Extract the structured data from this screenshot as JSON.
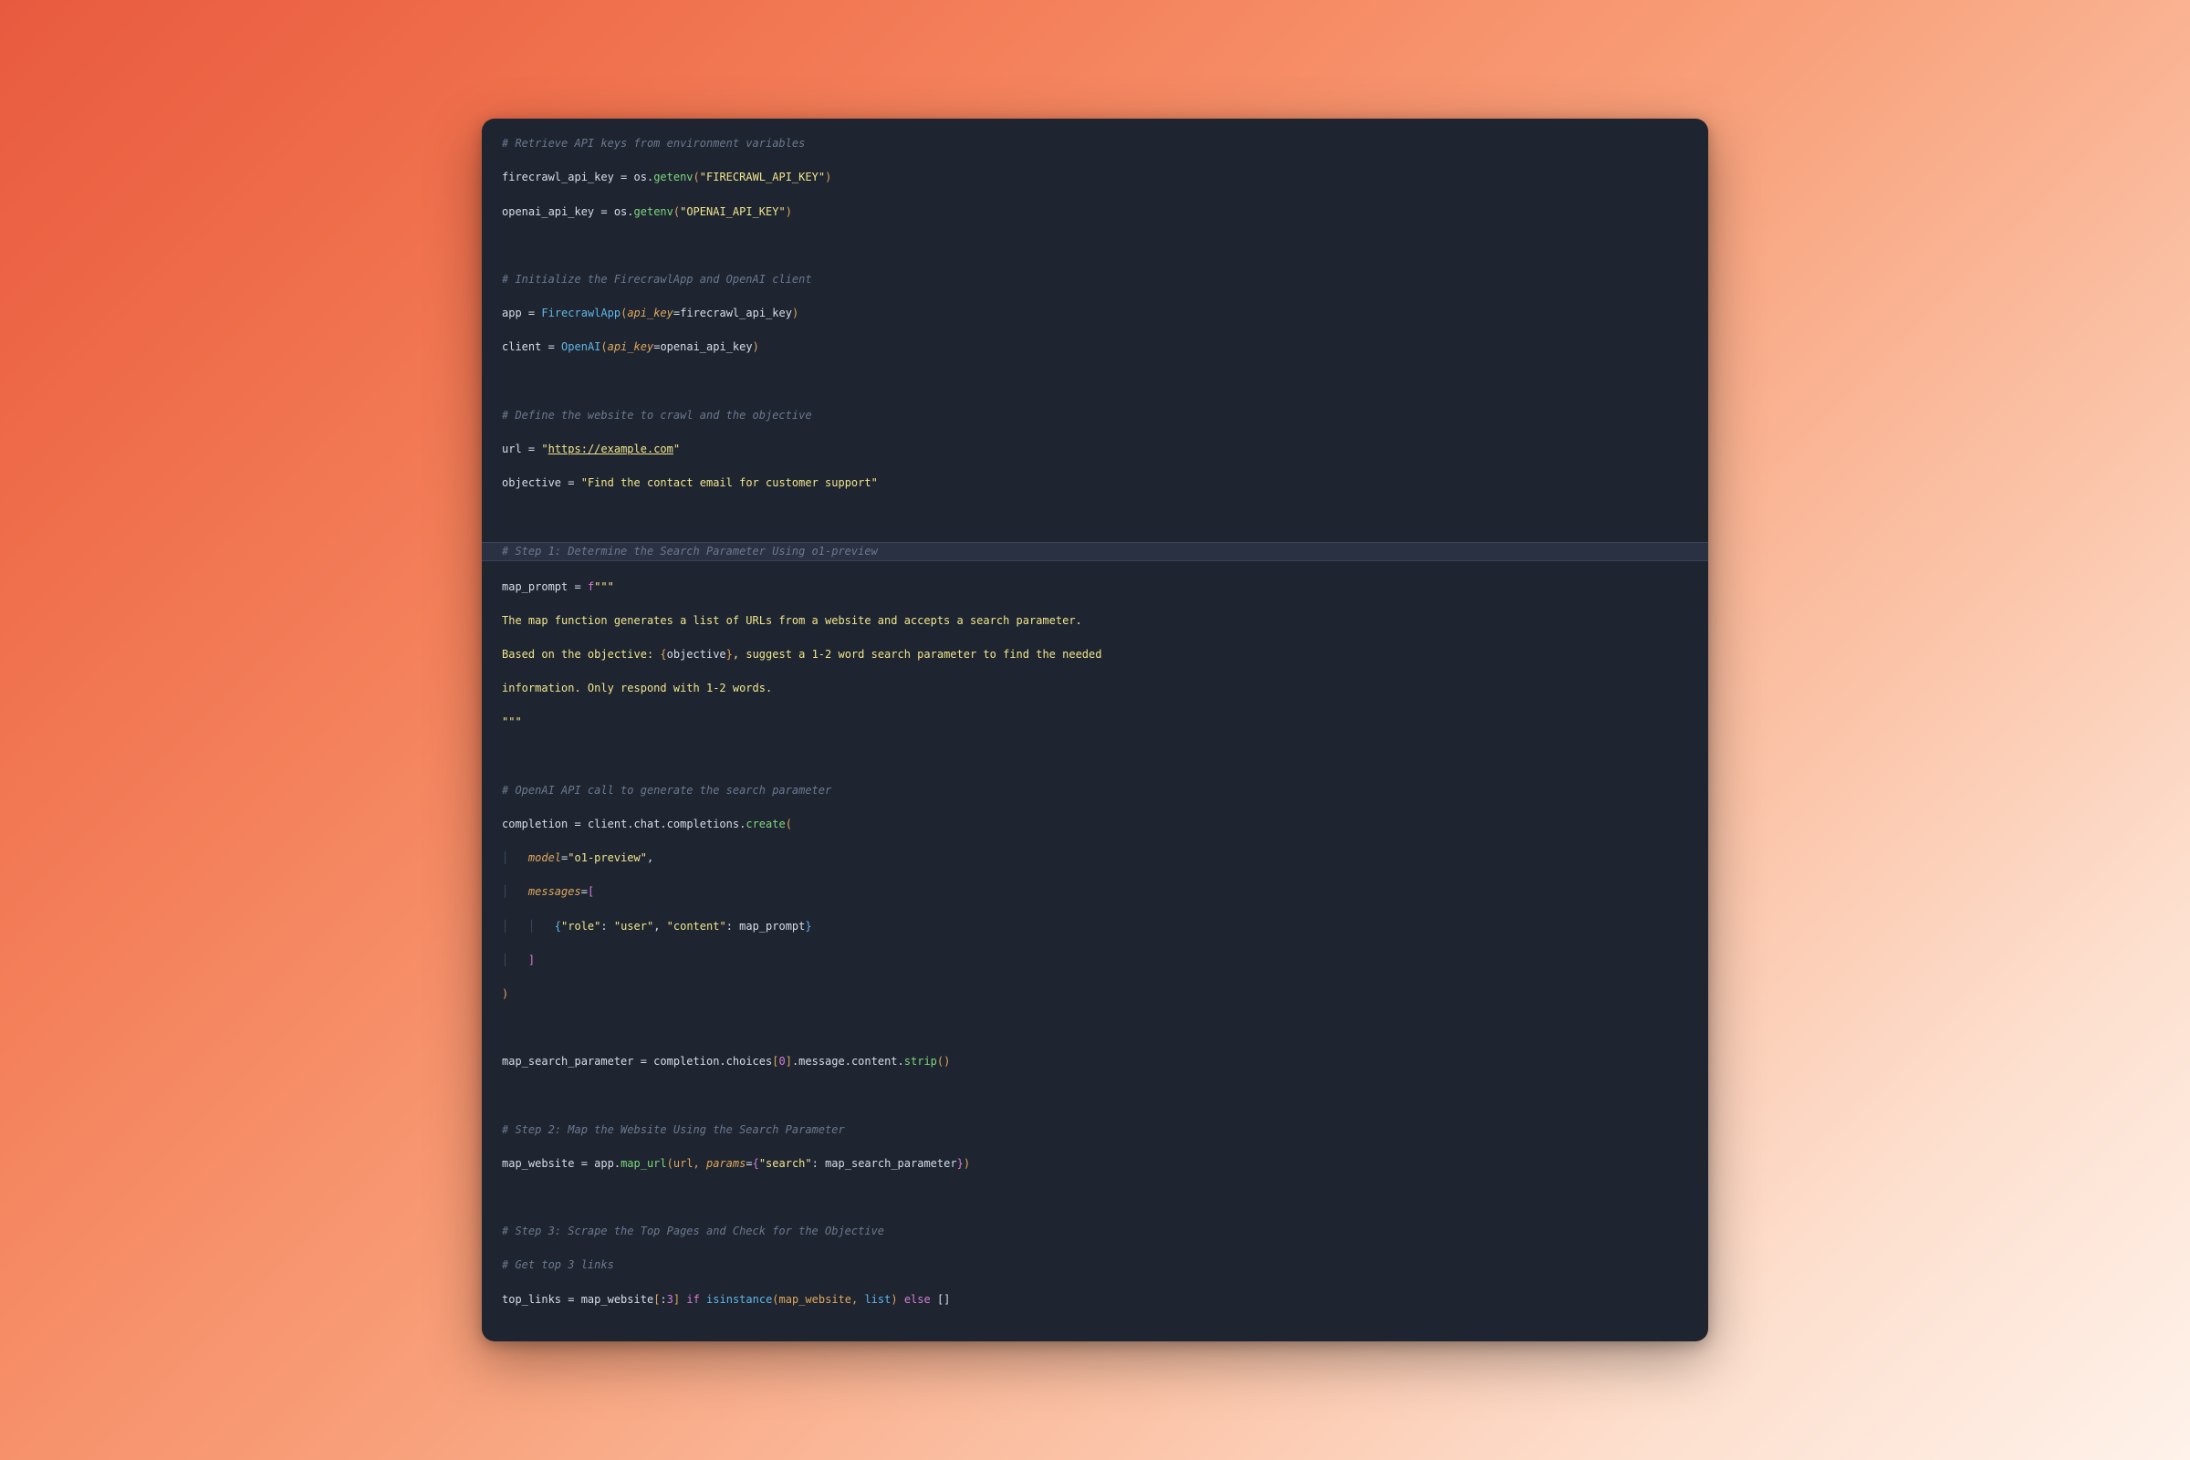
{
  "code": {
    "l1": "# Retrieve API keys from environment variables",
    "l2a": "firecrawl_api_key ",
    "l2b": "=",
    "l2c": " os.",
    "l2d": "getenv",
    "l2e": "(",
    "l2f": "\"FIRECRAWL_API_KEY\"",
    "l2g": ")",
    "l3a": "openai_api_key ",
    "l3b": "=",
    "l3c": " os.",
    "l3d": "getenv",
    "l3e": "(",
    "l3f": "\"OPENAI_API_KEY\"",
    "l3g": ")",
    "l5": "# Initialize the FirecrawlApp and OpenAI client",
    "l6a": "app ",
    "l6b": "=",
    "l6c": " ",
    "l6d": "FirecrawlApp",
    "l6e": "(",
    "l6f": "api_key",
    "l6g": "=",
    "l6h": "firecrawl_api_key",
    "l6i": ")",
    "l7a": "client ",
    "l7b": "=",
    "l7c": " ",
    "l7d": "OpenAI",
    "l7e": "(",
    "l7f": "api_key",
    "l7g": "=",
    "l7h": "openai_api_key",
    "l7i": ")",
    "l9": "# Define the website to crawl and the objective",
    "l10a": "url ",
    "l10b": "=",
    "l10c": " ",
    "l10d": "\"",
    "l10e": "https://example.com",
    "l10f": "\"",
    "l11a": "objective ",
    "l11b": "=",
    "l11c": " ",
    "l11d": "\"Find the contact email for customer support\"",
    "l13": "# Step 1: Determine the Search Parameter Using o1-preview",
    "l14a": "map_prompt ",
    "l14b": "=",
    "l14c": " ",
    "l14d": "f",
    "l14e": "\"\"\"",
    "l15": "The map function generates a list of URLs from a website and accepts a search parameter.",
    "l16a": "Based on the objective: ",
    "l16b": "{",
    "l16c": "objective",
    "l16d": "}",
    "l16e": ", suggest a 1-2 word search parameter to find the needed",
    "l17": "information. Only respond with 1-2 words.",
    "l18": "\"\"\"",
    "l20": "# OpenAI API call to generate the search parameter",
    "l21a": "completion ",
    "l21b": "=",
    "l21c": " client.chat.completions.",
    "l21d": "create",
    "l21e": "(",
    "l22a": "    ",
    "l22b": "model",
    "l22c": "=",
    "l22d": "\"o1-preview\"",
    "l22e": ",",
    "l23a": "    ",
    "l23b": "messages",
    "l23c": "=",
    "l23d": "[",
    "l24a": "        ",
    "l24b": "{",
    "l24c": "\"role\"",
    "l24d": ": ",
    "l24e": "\"user\"",
    "l24f": ", ",
    "l24g": "\"content\"",
    "l24h": ": map_prompt",
    "l24i": "}",
    "l25a": "    ",
    "l25b": "]",
    "l26": ")",
    "l28a": "map_search_parameter ",
    "l28b": "=",
    "l28c": " completion.choices",
    "l28d": "[",
    "l28e": "0",
    "l28f": "]",
    "l28g": ".message.content.",
    "l28h": "strip",
    "l28i": "()",
    "l30": "# Step 2: Map the Website Using the Search Parameter",
    "l31a": "map_website ",
    "l31b": "=",
    "l31c": " app.",
    "l31d": "map_url",
    "l31e": "(url, ",
    "l31f": "params",
    "l31g": "=",
    "l31h": "{",
    "l31i": "\"search\"",
    "l31j": ": map_search_parameter",
    "l31k": "}",
    "l31l": ")",
    "l33": "# Step 3: Scrape the Top Pages and Check for the Objective",
    "l34": "# Get top 3 links",
    "l35a": "top_links ",
    "l35b": "=",
    "l35c": " map_website",
    "l35d": "[",
    "l35e": ":",
    "l35f": "3",
    "l35g": "]",
    "l35h": " ",
    "l35i": "if",
    "l35j": " ",
    "l35k": "isinstance",
    "l35l": "(map_website, ",
    "l35m": "list",
    "l35n": ") ",
    "l35o": "else",
    "l35p": " []"
  }
}
